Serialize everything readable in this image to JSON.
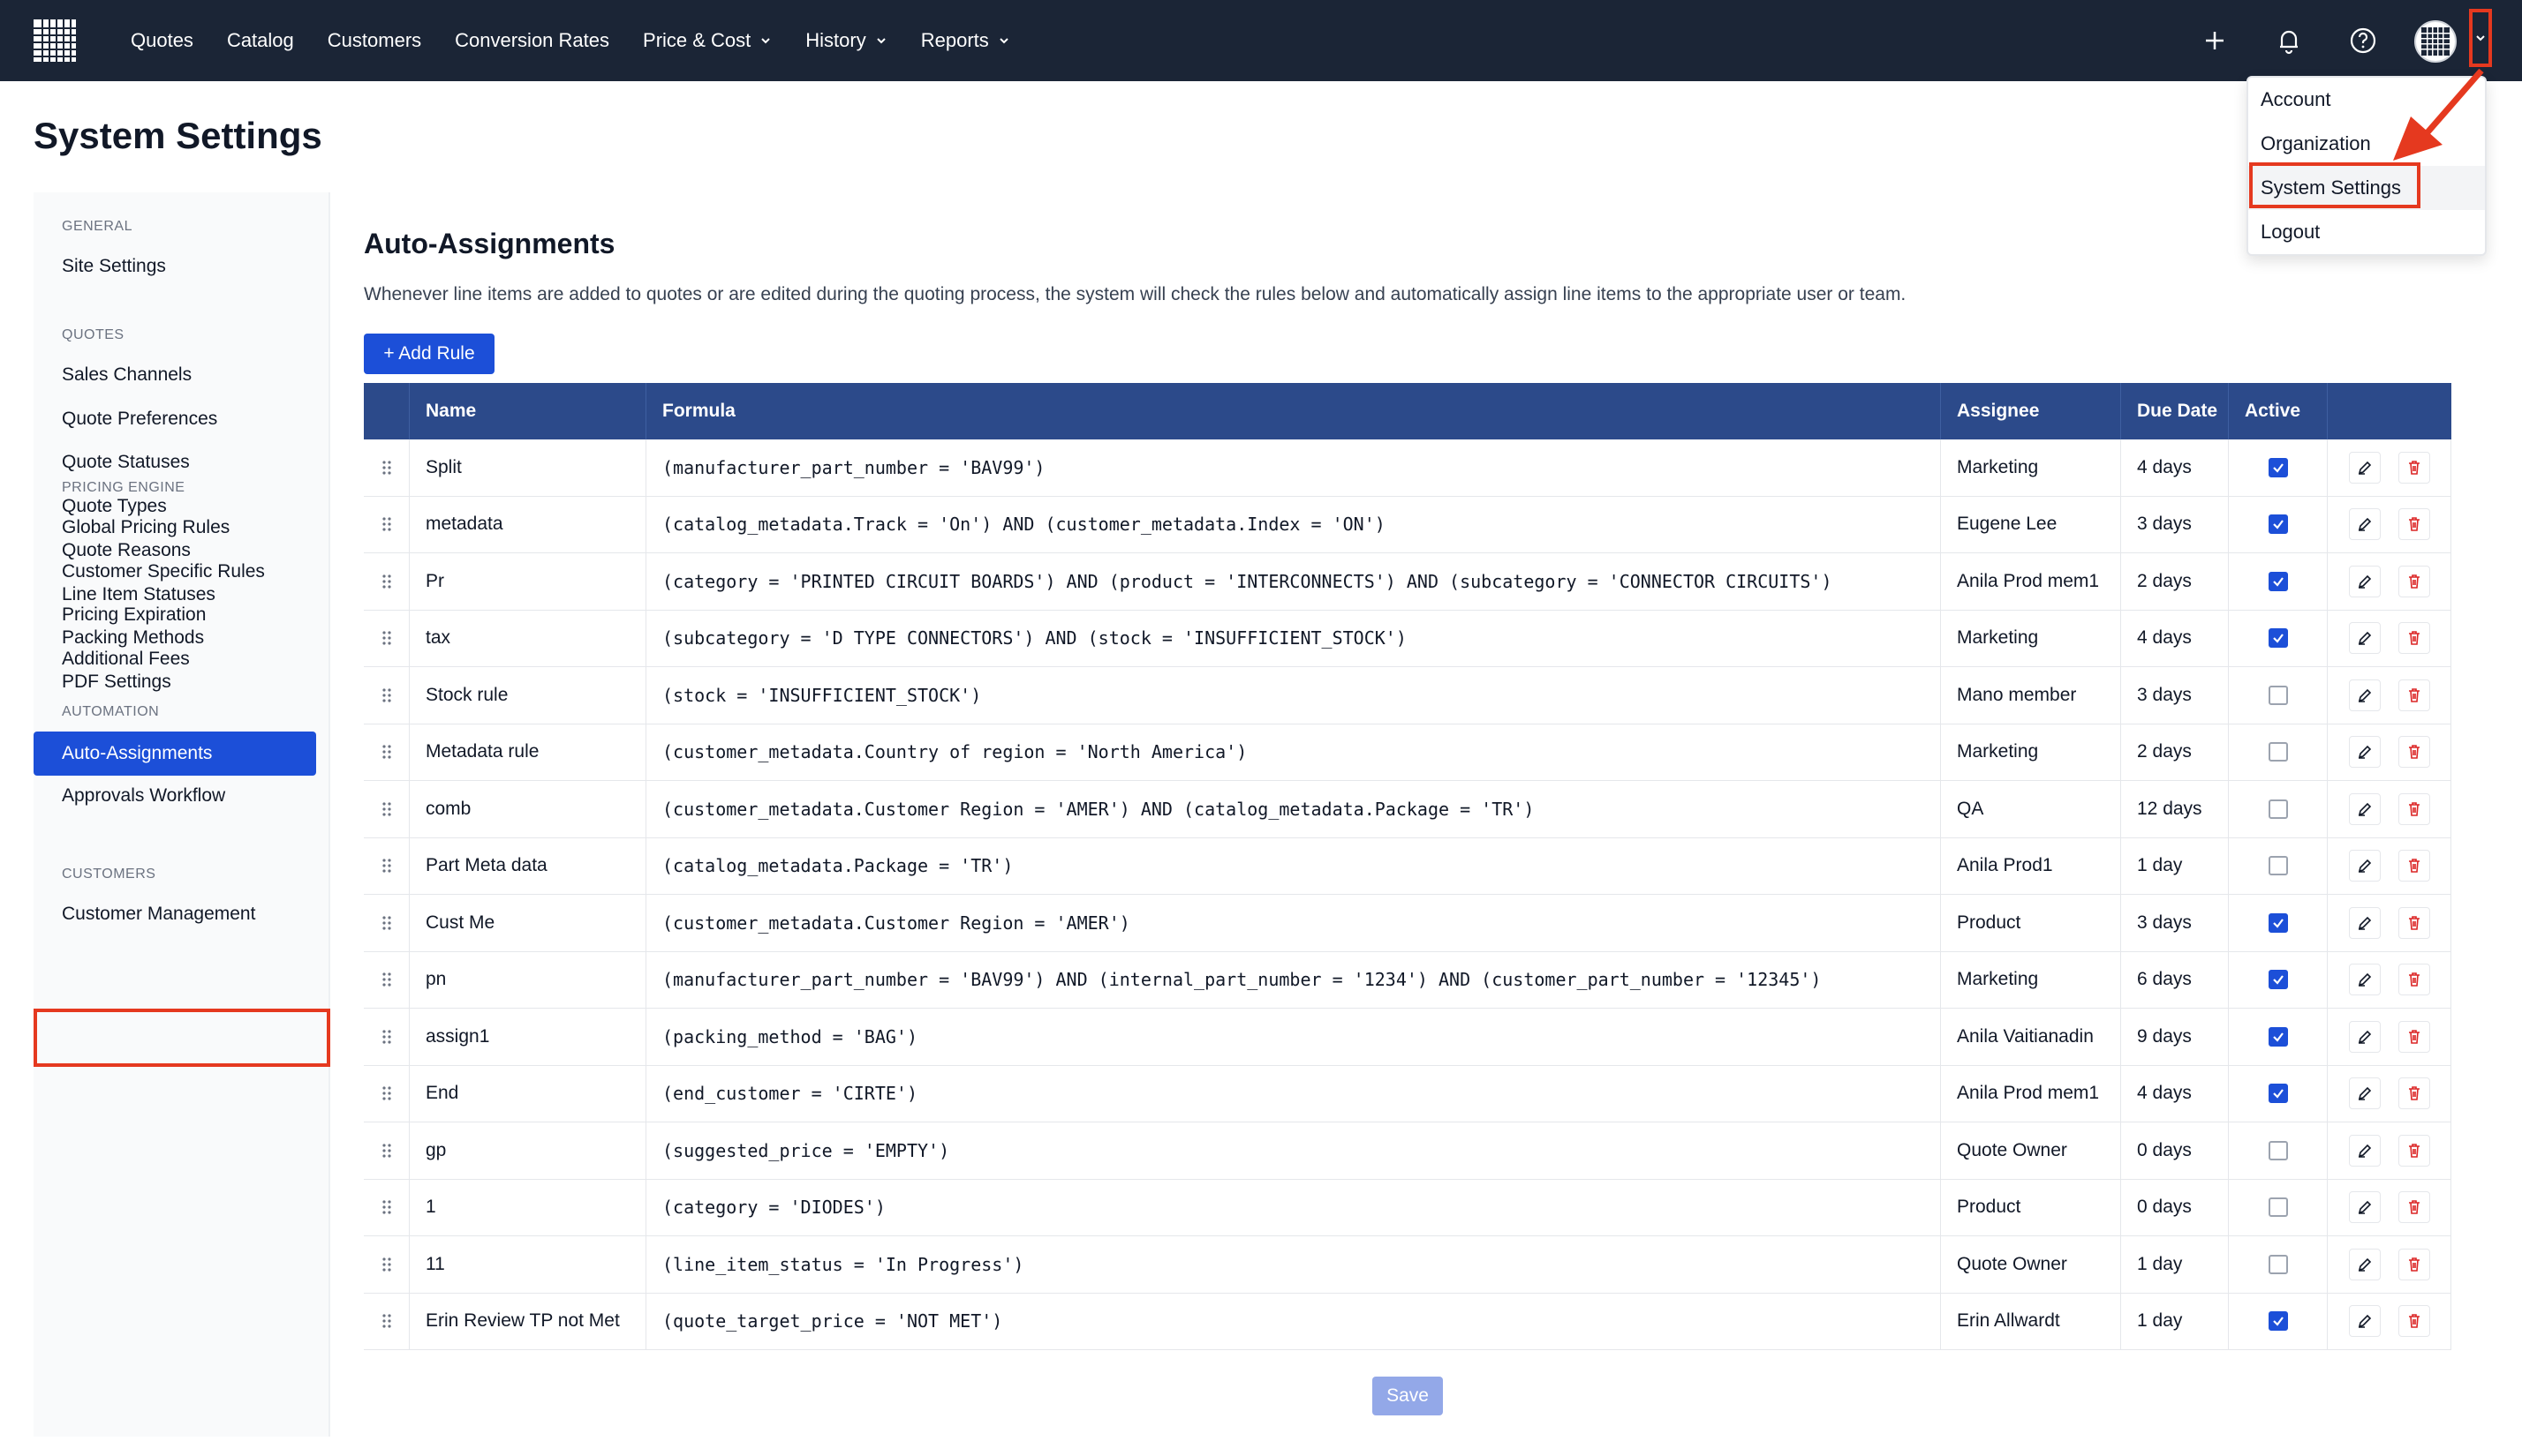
{
  "nav": {
    "links": [
      {
        "label": "Quotes",
        "dropdown": false
      },
      {
        "label": "Catalog",
        "dropdown": false
      },
      {
        "label": "Customers",
        "dropdown": false
      },
      {
        "label": "Conversion Rates",
        "dropdown": false
      },
      {
        "label": "Price & Cost",
        "dropdown": true
      },
      {
        "label": "History",
        "dropdown": true
      },
      {
        "label": "Reports",
        "dropdown": true
      }
    ],
    "icons": [
      "plus-icon",
      "bell-icon",
      "help-icon",
      "avatar-grid-icon",
      "chevron-down-icon"
    ]
  },
  "user_menu": {
    "items": [
      "Account",
      "Organization",
      "System Settings",
      "Logout"
    ],
    "highlighted": "System Settings"
  },
  "page": {
    "title": "System Settings"
  },
  "sidebar": {
    "sections": [
      {
        "title": "GENERAL",
        "items": [
          "Site Settings"
        ]
      },
      {
        "title": "QUOTES",
        "items": [
          "Sales Channels",
          "Quote Preferences",
          "Quote Statuses",
          "Quote Types",
          "Quote Reasons",
          "Line Item Statuses",
          "Packing Methods",
          "PDF Settings"
        ]
      },
      {
        "title": "PRICING ENGINE",
        "items": [
          "Global Pricing Rules",
          "Customer Specific Rules",
          "Pricing Expiration",
          "Additional Fees"
        ]
      },
      {
        "title": "AUTOMATION",
        "items": [
          "Auto-Assignments",
          "Approvals Workflow"
        ]
      },
      {
        "title": "CUSTOMERS",
        "items": [
          "Customer Management"
        ]
      }
    ],
    "active": "Auto-Assignments"
  },
  "main": {
    "title": "Auto-Assignments",
    "description": "Whenever line items are added to quotes or are edited during the quoting process, the system will check the rules below and automatically assign line items to the appropriate user or team.",
    "add_button": "+ Add Rule",
    "save_button": "Save",
    "columns": [
      "Name",
      "Formula",
      "Assignee",
      "Due Date",
      "Active"
    ],
    "rows": [
      {
        "name": "Split",
        "formula": "(manufacturer_part_number = 'BAV99')",
        "assignee": "Marketing",
        "due": "4 days",
        "active": true
      },
      {
        "name": "metadata",
        "formula": "(catalog_metadata.Track = 'On') AND (customer_metadata.Index = 'ON')",
        "assignee": "Eugene Lee",
        "due": "3 days",
        "active": true
      },
      {
        "name": "Pr",
        "formula": "(category = 'PRINTED CIRCUIT BOARDS') AND (product = 'INTERCONNECTS') AND (subcategory = 'CONNECTOR CIRCUITS')",
        "assignee": "Anila Prod mem1",
        "due": "2 days",
        "active": true
      },
      {
        "name": "tax",
        "formula": "(subcategory = 'D TYPE CONNECTORS') AND (stock = 'INSUFFICIENT_STOCK')",
        "assignee": "Marketing",
        "due": "4 days",
        "active": true
      },
      {
        "name": "Stock rule",
        "formula": "(stock = 'INSUFFICIENT_STOCK')",
        "assignee": "Mano member",
        "due": "3 days",
        "active": false
      },
      {
        "name": "Metadata rule",
        "formula": "(customer_metadata.Country of region = 'North America')",
        "assignee": "Marketing",
        "due": "2 days",
        "active": false
      },
      {
        "name": "comb",
        "formula": "(customer_metadata.Customer Region = 'AMER') AND (catalog_metadata.Package = 'TR')",
        "assignee": "QA",
        "due": "12 days",
        "active": false
      },
      {
        "name": "Part Meta data",
        "formula": "(catalog_metadata.Package = 'TR')",
        "assignee": "Anila Prod1",
        "due": "1 day",
        "active": false
      },
      {
        "name": "Cust Me",
        "formula": "(customer_metadata.Customer Region = 'AMER')",
        "assignee": "Product",
        "due": "3 days",
        "active": true
      },
      {
        "name": "pn",
        "formula": "(manufacturer_part_number = 'BAV99') AND (internal_part_number = '1234') AND (customer_part_number = '12345')",
        "assignee": "Marketing",
        "due": "6 days",
        "active": true
      },
      {
        "name": "assign1",
        "formula": "(packing_method = 'BAG')",
        "assignee": "Anila Vaitianadin",
        "due": "9 days",
        "active": true
      },
      {
        "name": "End",
        "formula": "(end_customer = 'CIRTE')",
        "assignee": "Anila Prod mem1",
        "due": "4 days",
        "active": true
      },
      {
        "name": "gp",
        "formula": "(suggested_price = 'EMPTY')",
        "assignee": "Quote Owner",
        "due": "0 days",
        "active": false
      },
      {
        "name": "1",
        "formula": "(category = 'DIODES')",
        "assignee": "Product",
        "due": "0 days",
        "active": false
      },
      {
        "name": "11",
        "formula": "(line_item_status = 'In Progress')",
        "assignee": "Quote Owner",
        "due": "1 day",
        "active": false
      },
      {
        "name": "Erin Review TP not Met",
        "formula": "(quote_target_price = 'NOT MET')",
        "assignee": "Erin Allwardt",
        "due": "1 day",
        "active": true
      }
    ]
  },
  "colors": {
    "nav_bg": "#1b2536",
    "accent": "#1c4fd8",
    "table_header": "#2c4a8a",
    "annotation_red": "#e5391f",
    "delete_red": "#dc2626"
  }
}
